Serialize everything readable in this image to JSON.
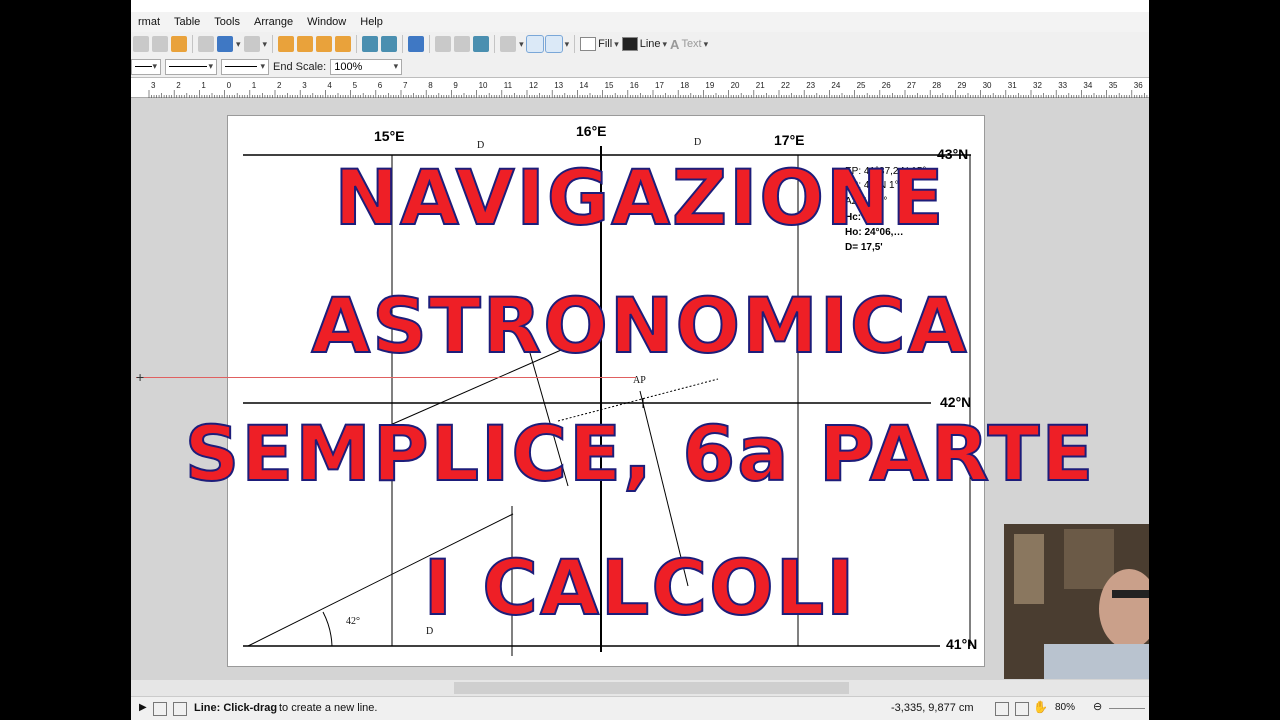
{
  "menu": [
    "rmat",
    "Table",
    "Tools",
    "Arrange",
    "Window",
    "Help"
  ],
  "toolbar": {
    "fill_label": "Fill",
    "line_label": "Line",
    "text_label": "Text",
    "end_scale_label": "End Scale:",
    "end_scale_value": "100%"
  },
  "ruler": {
    "numbers": [
      "3",
      "2",
      "1",
      "0",
      "1",
      "2",
      "3",
      "4",
      "5",
      "6",
      "7",
      "8",
      "9",
      "10",
      "11",
      "12",
      "13",
      "14",
      "15",
      "16",
      "17",
      "18",
      "19",
      "20",
      "21",
      "22",
      "23",
      "24",
      "25",
      "26",
      "27",
      "28",
      "29",
      "30",
      "31",
      "32",
      "33",
      "34",
      "35",
      "36"
    ]
  },
  "chart": {
    "longitudes": [
      "15°E",
      "16°E",
      "17°E"
    ],
    "latitudes": [
      "43°N",
      "42°N",
      "41°N"
    ],
    "marks": {
      "d1": "D",
      "d2": "D",
      "d3": "D",
      "ap": "AP",
      "angle": "42°"
    },
    "notes": [
      "EP: 41°37,2 N 15°",
      "AP: 41°N   1°1 E",
      "Az: 16…°",
      "Hc: 24",
      "Ho: 24°06,…",
      "D= 17,5'"
    ]
  },
  "overlay": {
    "line1": "NAVIGAZIONE",
    "line2": "ASTRONOMICA",
    "line3": "SEMPLICE,  6a PARTE",
    "line4": "I CALCOLI"
  },
  "status": {
    "tool_bold": "Line: Click-drag",
    "tool_rest": " to create a new line.",
    "coords": "-3,335,  9,877 cm",
    "zoom": "80%"
  }
}
